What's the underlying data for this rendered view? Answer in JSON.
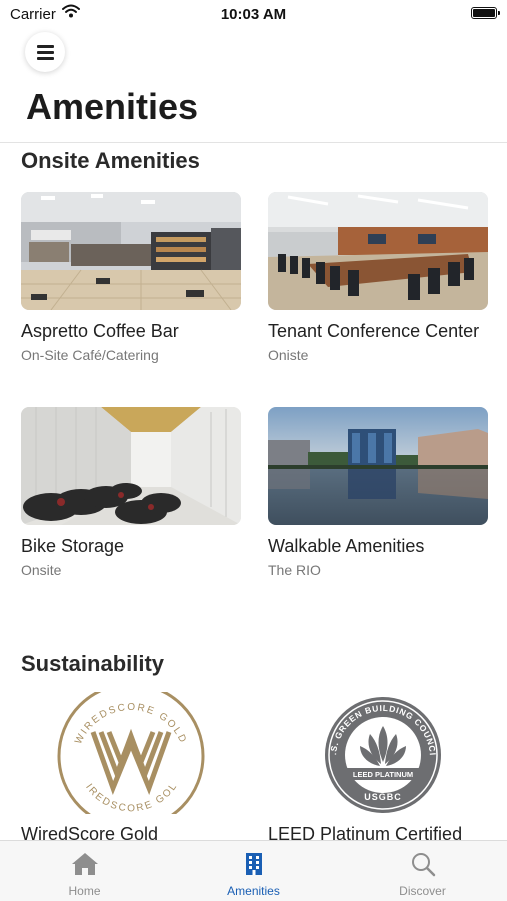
{
  "status_bar": {
    "carrier": "Carrier",
    "time": "10:03 AM"
  },
  "header": {
    "title": "Amenities",
    "menu_icon": "hamburger-menu-icon"
  },
  "onsite": {
    "title": "Onsite Amenities",
    "items": [
      {
        "name": "Aspretto Coffee Bar",
        "subtitle": "On-Site Café/Catering",
        "image": "coffee-bar-photo"
      },
      {
        "name": "Tenant Conference Center",
        "subtitle": "Oniste",
        "image": "conference-room-photo"
      },
      {
        "name": "Bike Storage",
        "subtitle": "Onsite",
        "image": "bike-storage-photo"
      },
      {
        "name": "Walkable Amenities",
        "subtitle": "The RIO",
        "image": "waterfront-photo"
      }
    ]
  },
  "sustainability": {
    "title": "Sustainability",
    "items": [
      {
        "name": "WiredScore Gold",
        "badge_text_top": "WIREDSCORE GOLD",
        "badge_text_bottom": "WIREDSCORE GOLD"
      },
      {
        "name": "LEED Platinum Certified",
        "badge_ring_text": "U.S. GREEN BUILDING COUNCIL",
        "badge_banner": "LEED PLATINUM",
        "badge_org": "USGBC"
      }
    ]
  },
  "tabbar": {
    "tabs": [
      {
        "label": "Home",
        "icon": "home-icon",
        "active": false
      },
      {
        "label": "Amenities",
        "icon": "building-icon",
        "active": true
      },
      {
        "label": "Discover",
        "icon": "search-icon",
        "active": false
      }
    ]
  },
  "colors": {
    "accent": "#1a5fb4",
    "inactive": "#8e8e8e",
    "gold": "#a88f62",
    "usgbc_gray": "#6d6e71"
  }
}
